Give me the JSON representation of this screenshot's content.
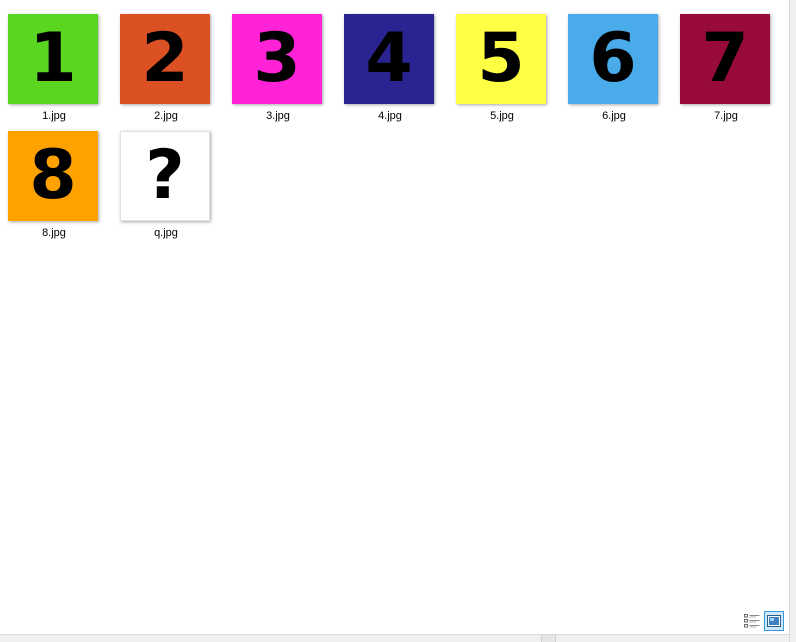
{
  "files": [
    {
      "name": "1.jpg",
      "glyph": "1",
      "bg": "#5ad621"
    },
    {
      "name": "2.jpg",
      "glyph": "2",
      "bg": "#dc5124"
    },
    {
      "name": "3.jpg",
      "glyph": "3",
      "bg": "#ff22d7"
    },
    {
      "name": "4.jpg",
      "glyph": "4",
      "bg": "#2a2493"
    },
    {
      "name": "5.jpg",
      "glyph": "5",
      "bg": "#ffff44"
    },
    {
      "name": "6.jpg",
      "glyph": "6",
      "bg": "#4aabea"
    },
    {
      "name": "7.jpg",
      "glyph": "7",
      "bg": "#980a3a"
    },
    {
      "name": "8.jpg",
      "glyph": "8",
      "bg": "#ffa200"
    },
    {
      "name": "q.jpg",
      "glyph": "?",
      "bg": "#ffffff"
    }
  ],
  "view_buttons": {
    "details": {
      "icon": "details-view-icon"
    },
    "large_icons": {
      "icon": "large-icons-view-icon",
      "selected": true
    }
  }
}
